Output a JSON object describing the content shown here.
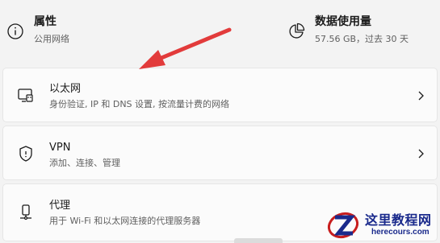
{
  "properties": {
    "title": "属性",
    "subtitle": "公用网络",
    "icon": "info-icon"
  },
  "data_usage": {
    "title": "数据使用量",
    "subtitle": "57.56 GB，过去 30 天",
    "icon": "pie-chart-icon"
  },
  "cards": [
    {
      "title": "以太网",
      "subtitle": "身份验证, IP 和 DNS 设置, 按流量计费的网络",
      "icon": "ethernet-icon"
    },
    {
      "title": "VPN",
      "subtitle": "添加、连接、管理",
      "icon": "shield-icon"
    },
    {
      "title": "代理",
      "subtitle": "用于 Wi-Fi 和以太网连接的代理服务器",
      "icon": "proxy-icon"
    }
  ],
  "watermark": {
    "name": "这里教程网",
    "url": "herecours.com"
  },
  "colors": {
    "arrow": "#e23b3b",
    "watermark": "#1a2a8c",
    "logo_red": "#c81e1e"
  }
}
